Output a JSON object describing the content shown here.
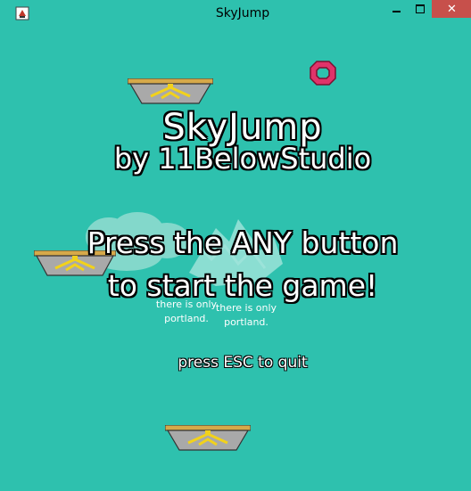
{
  "window": {
    "title": "SkyJump",
    "close_label": "✕"
  },
  "game": {
    "title": "SkyJump",
    "credit": "by 11BelowStudio",
    "prompt_line1": "Press the ANY button",
    "prompt_line2": "to start the game!",
    "quit_hint": "press ESC to quit",
    "sign_left": [
      "there is only",
      "portland."
    ],
    "sign_right": [
      "there is only",
      "portland."
    ]
  },
  "colors": {
    "background": "#2ec1ae",
    "text": "#ffffff",
    "outline": "#000000",
    "platform_top": "#d6a94a",
    "platform_body": "#a9a9a9",
    "platform_gem": "#f2d21b",
    "ring": "#e0336a"
  },
  "icons": {
    "app": "game-icon",
    "minimize": "minimize-icon",
    "maximize": "maximize-icon",
    "close": "close-icon"
  }
}
